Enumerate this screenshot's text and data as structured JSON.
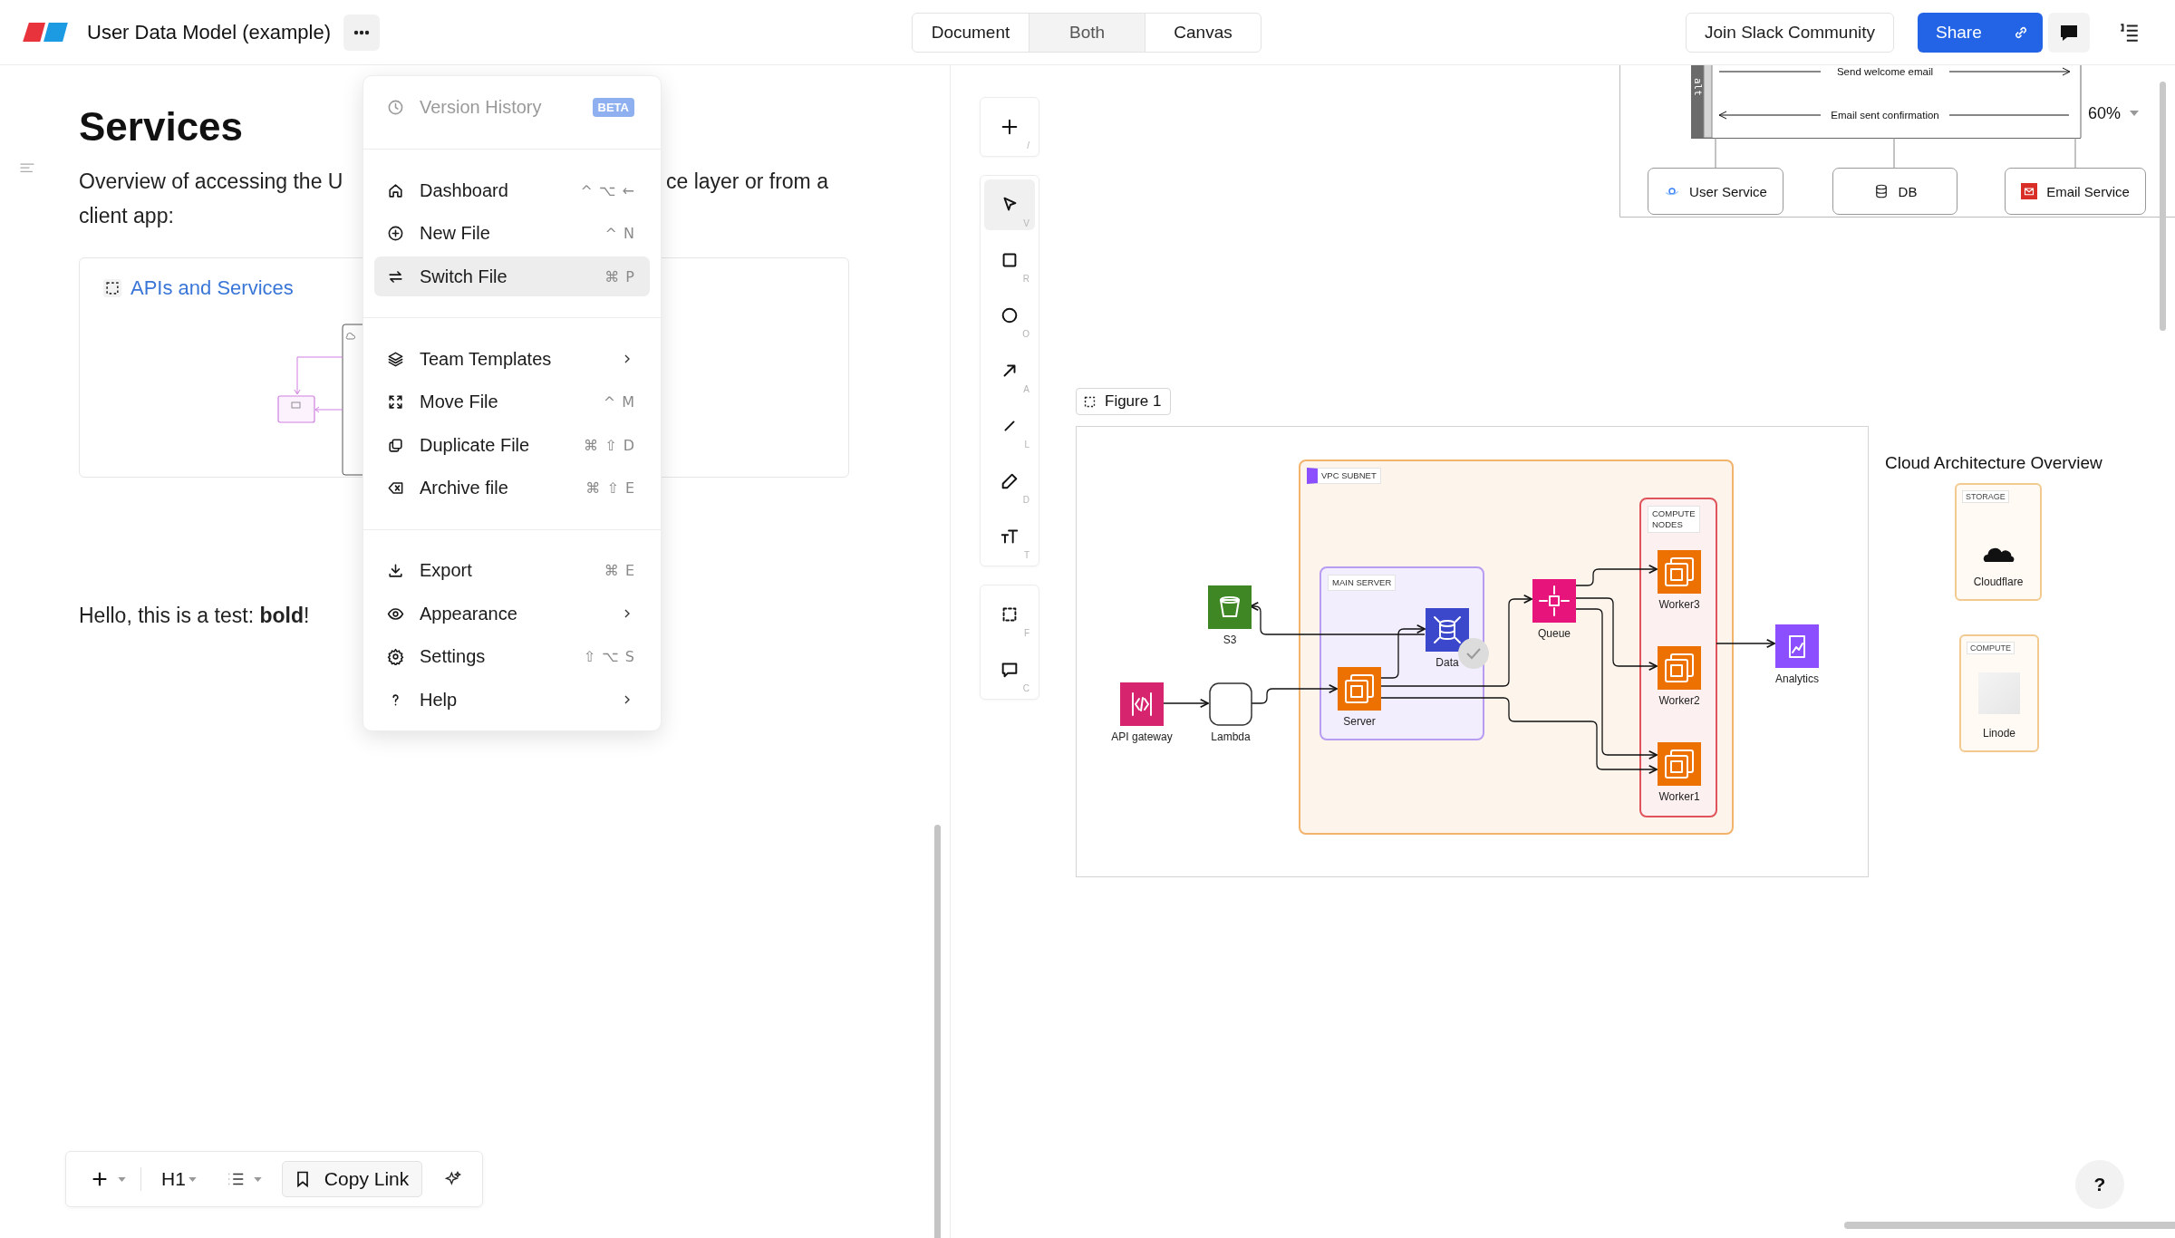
{
  "header": {
    "title": "User Data Model (example)",
    "view_modes": [
      {
        "label": "Document",
        "selected": false
      },
      {
        "label": "Both",
        "selected": true
      },
      {
        "label": "Canvas",
        "selected": false
      }
    ],
    "community_button": "Join Slack Community",
    "share_button": "Share"
  },
  "document": {
    "heading": "Services",
    "paragraph_parts": [
      "Overview of accessing the U",
      "ce layer or from a",
      "client app:"
    ],
    "embed": {
      "title": "APIs and Services"
    },
    "test_line": "Hello, this is a test: **bold**!"
  },
  "menu": {
    "sections": [
      {
        "items": [
          {
            "label": "Version History",
            "badge": "BETA",
            "selected": false,
            "disabled": true,
            "submenu": false
          }
        ]
      },
      {
        "items": [
          {
            "label": "Dashboard",
            "shortcut": "^ ⌥ ←",
            "selected": false,
            "disabled": false,
            "submenu": false
          },
          {
            "label": "New File",
            "shortcut": "^ N",
            "selected": false,
            "disabled": false,
            "submenu": false
          },
          {
            "label": "Switch File",
            "shortcut": "⌘ P",
            "selected": true,
            "disabled": false,
            "submenu": false
          }
        ]
      },
      {
        "items": [
          {
            "label": "Team Templates",
            "selected": false,
            "disabled": false,
            "submenu": true
          },
          {
            "label": "Move File",
            "shortcut": "^ M",
            "selected": false,
            "disabled": false,
            "submenu": false
          },
          {
            "label": "Duplicate File",
            "shortcut": "⌘ ⇧ D",
            "selected": false,
            "disabled": false,
            "submenu": false
          },
          {
            "label": "Archive file",
            "shortcut": "⌘ ⇧ E",
            "selected": false,
            "disabled": false,
            "submenu": false
          }
        ]
      },
      {
        "items": [
          {
            "label": "Export",
            "shortcut": "⌘ E",
            "selected": false,
            "disabled": false,
            "submenu": false
          },
          {
            "label": "Appearance",
            "selected": false,
            "disabled": false,
            "submenu": true
          },
          {
            "label": "Settings",
            "shortcut": "⇧ ⌥ S",
            "selected": false,
            "disabled": false,
            "submenu": false
          },
          {
            "label": "Help",
            "selected": false,
            "disabled": false,
            "submenu": true
          }
        ]
      }
    ]
  },
  "doc_toolbar": {
    "heading_button": "H1",
    "copy_link_button": "Copy Link"
  },
  "canvas_toolbar": {
    "groups": [
      {
        "tools": [
          {
            "key": "/",
            "selected": false
          }
        ]
      },
      {
        "tools": [
          {
            "key": "V",
            "selected": true
          },
          {
            "key": "R",
            "selected": false
          },
          {
            "key": "O",
            "selected": false
          },
          {
            "key": "A",
            "selected": false
          },
          {
            "key": "L",
            "selected": false
          },
          {
            "key": "D",
            "selected": false
          },
          {
            "key": "T",
            "selected": false
          }
        ]
      },
      {
        "tools": [
          {
            "key": "F",
            "selected": false
          },
          {
            "key": "C",
            "selected": false
          }
        ]
      }
    ]
  },
  "sequence_diagram": {
    "fragment": "alt",
    "messages": [
      {
        "label": "Send welcome email",
        "kind": "request"
      },
      {
        "label": "Email sent confirmation",
        "kind": "reply"
      }
    ],
    "participants": [
      {
        "label": "User Service",
        "kind": "service"
      },
      {
        "label": "DB",
        "kind": "database"
      },
      {
        "label": "Email Service",
        "kind": "email"
      }
    ]
  },
  "zoom": {
    "value": "60%"
  },
  "figure": {
    "label": "Figure 1",
    "groups": [
      {
        "label": "VPC SUBNET",
        "kind": "vpc"
      },
      {
        "label": "MAIN SERVER",
        "kind": "server"
      },
      {
        "label": "COMPUTE NODES",
        "kind": "compute"
      }
    ],
    "nodes": [
      {
        "label": "S3",
        "kind": "storage"
      },
      {
        "label": "API gateway",
        "kind": "gateway"
      },
      {
        "label": "Lambda",
        "kind": "function"
      },
      {
        "label": "Server",
        "kind": "compute"
      },
      {
        "label": "Data",
        "kind": "database"
      },
      {
        "label": "Queue",
        "kind": "queue"
      },
      {
        "label": "Worker3",
        "kind": "compute"
      },
      {
        "label": "Worker2",
        "kind": "compute"
      },
      {
        "label": "Worker1",
        "kind": "compute"
      },
      {
        "label": "Analytics",
        "kind": "analytics"
      }
    ]
  },
  "overview": {
    "title": "Cloud Architecture Overview",
    "cards": [
      {
        "tag": "STORAGE",
        "label": "Cloudflare",
        "kind": "storage"
      },
      {
        "tag": "COMPUTE",
        "label": "Linode",
        "kind": "compute"
      }
    ]
  },
  "help_button": "?"
}
